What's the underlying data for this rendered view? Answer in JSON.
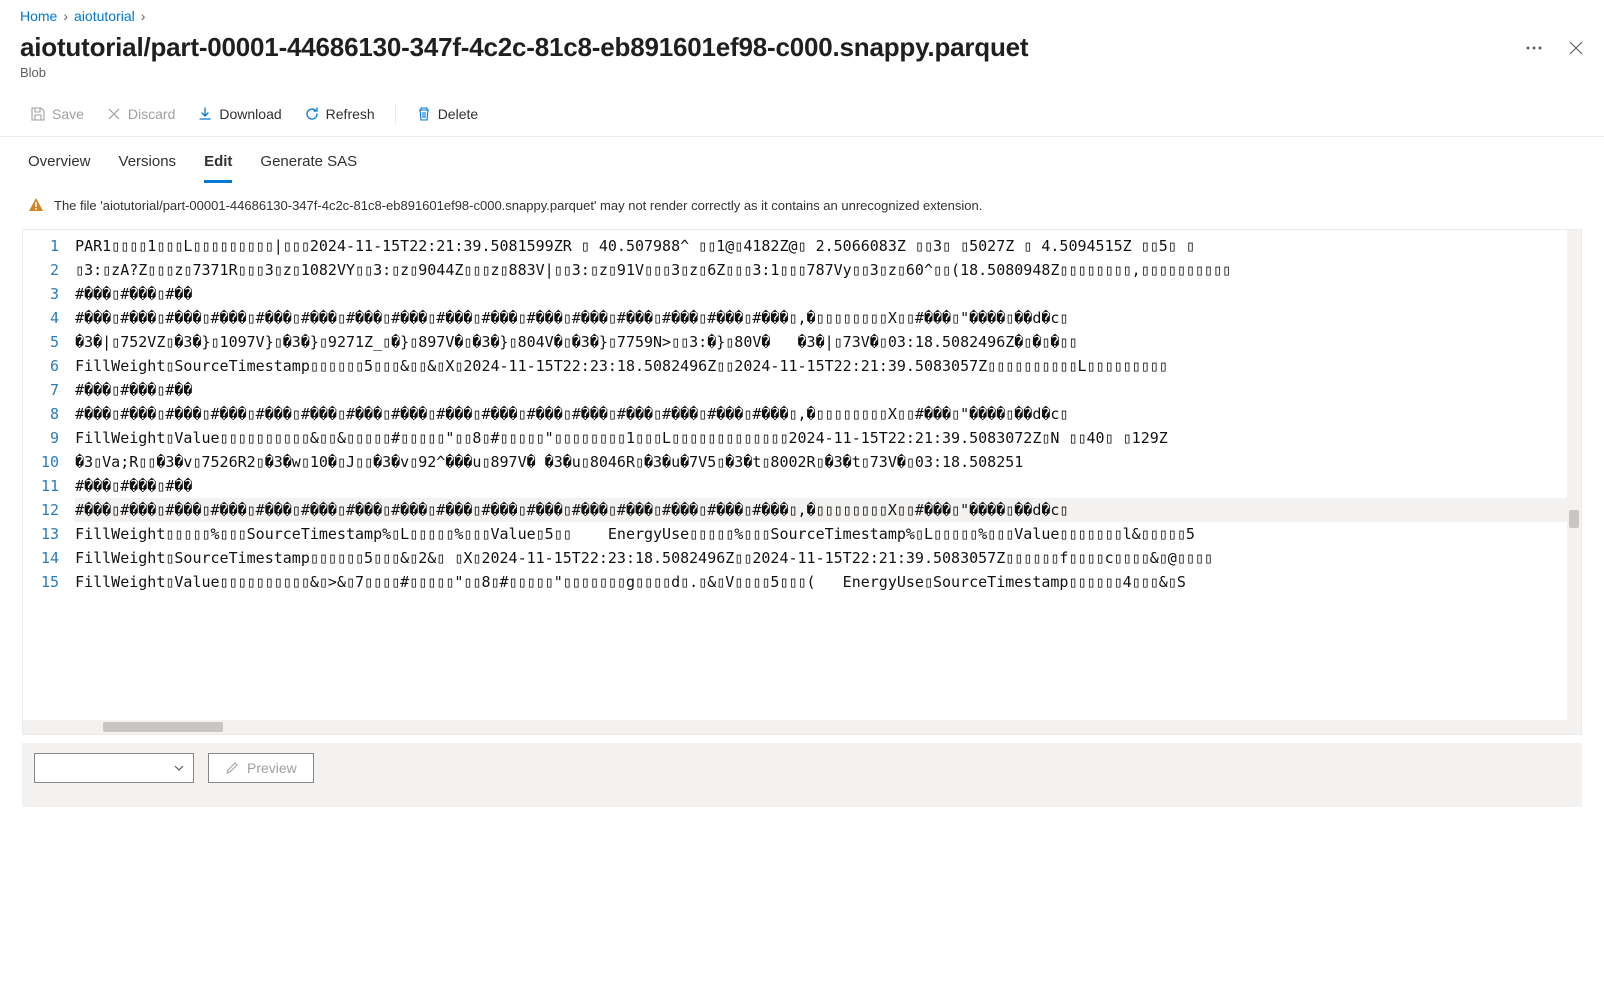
{
  "breadcrumb": {
    "home": "Home",
    "folder": "aiotutorial"
  },
  "title": "aiotutorial/part-00001-44686130-347f-4c2c-81c8-eb891601ef98-c000.snappy.parquet",
  "subtitle": "Blob",
  "toolbar": {
    "save": "Save",
    "discard": "Discard",
    "download": "Download",
    "refresh": "Refresh",
    "delete": "Delete"
  },
  "tabs": {
    "overview": "Overview",
    "versions": "Versions",
    "edit": "Edit",
    "generate_sas": "Generate SAS"
  },
  "warning": "The file 'aiotutorial/part-00001-44686130-347f-4c2c-81c8-eb891601ef98-c000.snappy.parquet' may not render correctly as it contains an unrecognized extension.",
  "footer": {
    "preview": "Preview"
  },
  "editor": {
    "line_numbers": [
      "1",
      "2",
      "3",
      "4",
      "5",
      "6",
      "7",
      "8",
      "9",
      "10",
      "11",
      "12",
      "13",
      "14",
      "15"
    ],
    "lines": [
      "PAR1▯▯▯▯1▯▯▯L▯▯▯▯▯▯▯▯▯|▯▯▯2024-11-15T22:21:39.5081599ZR ▯ 40.507988^ ▯▯1@▯4182Z@▯ 2.5066083Z ▯▯3▯ ▯5027Z ▯ 4.5094515Z ▯▯5▯ ▯",
      "▯3:▯zA?Z▯▯▯z▯7371R▯▯▯3▯z▯1082VY▯▯3:▯z▯9044Z▯▯▯z▯883V|▯▯3:▯z▯91V▯▯▯3▯z▯6Z▯▯▯3:1▯▯▯787Vy▯▯3▯z▯60^▯▯(18.5080948Z▯▯▯▯▯▯▯▯,▯▯▯▯▯▯▯▯▯▯",
      "#���▯#���▯#��",
      "#���▯#���▯#���▯#���▯#���▯#���▯#���▯#���▯#���▯#���▯#���▯#���▯#���▯#���▯#���▯#���▯,�▯▯▯▯▯▯▯▯X▯▯#���▯\"����▯��d�c▯",
      "�3�|▯752VZ▯�3�}▯1097V}▯�3�}▯9271Z_▯�}▯897V�▯�3�}▯804V�▯�3�}▯7759N>▯▯3:�}▯80V�   �3�|▯73V�▯03:18.5082496Z�▯�▯�▯▯",
      "FillWeight▯SourceTimestamp▯▯▯▯▯▯5▯▯▯&▯▯&▯X▯2024-11-15T22:23:18.5082496Z▯▯2024-11-15T22:21:39.5083057Z▯▯▯▯▯▯▯▯▯▯L▯▯▯▯▯▯▯▯▯",
      "#���▯#���▯#��",
      "#���▯#���▯#���▯#���▯#���▯#���▯#���▯#���▯#���▯#���▯#���▯#���▯#���▯#���▯#���▯#���▯,�▯▯▯▯▯▯▯▯X▯▯#���▯\"����▯��d�c▯",
      "FillWeight▯Value▯▯▯▯▯▯▯▯▯▯&▯▯&▯▯▯▯▯#▯▯▯▯▯\"▯▯8▯#▯▯▯▯▯\"▯▯▯▯▯▯▯▯1▯▯▯L▯▯▯▯▯▯▯▯▯▯▯▯▯2024-11-15T22:21:39.5083072Z▯N ▯▯40▯ ▯129Z",
      "�3▯Va;R▯▯�3�v▯7526R2▯�3�w▯10�▯J▯▯�3�v▯92^���u▯897V� �3�u▯8046R▯�3�u�7V5▯�3�t▯8002R▯�3�t▯73V�▯03:18.508251",
      "#���▯#���▯#��",
      "#���▯#���▯#���▯#���▯#���▯#���▯#���▯#���▯#���▯#���▯#���▯#���▯#���▯#���▯#���▯#���▯,�▯▯▯▯▯▯▯▯X▯▯#���▯\"����▯��d�c▯",
      "FillWeight▯▯▯▯▯%▯▯▯SourceTimestamp%▯L▯▯▯▯▯%▯▯▯Value▯5▯▯    EnergyUse▯▯▯▯▯%▯▯▯SourceTimestamp%▯L▯▯▯▯▯%▯▯▯Value▯▯▯▯▯▯▯l&▯▯▯▯▯5",
      "FillWeight▯SourceTimestamp▯▯▯▯▯▯5▯▯▯&▯2&▯ ▯X▯2024-11-15T22:23:18.5082496Z▯▯2024-11-15T22:21:39.5083057Z▯▯▯▯▯▯f▯▯▯▯c▯▯▯▯&▯@▯▯▯▯",
      "FillWeight▯Value▯▯▯▯▯▯▯▯▯▯&▯>&▯7▯▯▯▯#▯▯▯▯▯\"▯▯8▯#▯▯▯▯▯\"▯▯▯▯▯▯▯g▯▯▯▯d▯.▯&▯V▯▯▯▯5▯▯▯(   EnergyUse▯SourceTimestamp▯▯▯▯▯▯4▯▯▯&▯S"
    ],
    "current_line_index": 11
  }
}
